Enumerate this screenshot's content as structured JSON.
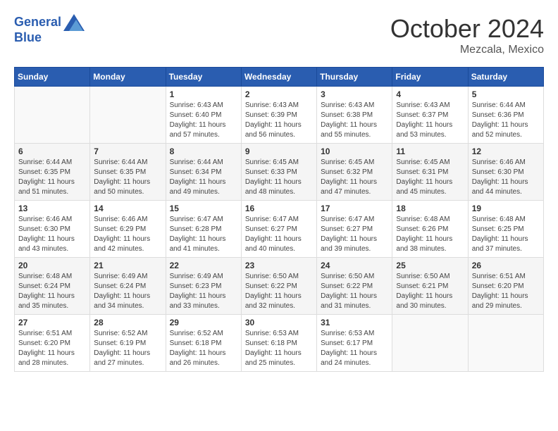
{
  "logo": {
    "line1": "General",
    "line2": "Blue"
  },
  "title": "October 2024",
  "location": "Mezcala, Mexico",
  "weekdays": [
    "Sunday",
    "Monday",
    "Tuesday",
    "Wednesday",
    "Thursday",
    "Friday",
    "Saturday"
  ],
  "weeks": [
    [
      {
        "day": "",
        "info": ""
      },
      {
        "day": "",
        "info": ""
      },
      {
        "day": "1",
        "info": "Sunrise: 6:43 AM\nSunset: 6:40 PM\nDaylight: 11 hours\nand 57 minutes."
      },
      {
        "day": "2",
        "info": "Sunrise: 6:43 AM\nSunset: 6:39 PM\nDaylight: 11 hours\nand 56 minutes."
      },
      {
        "day": "3",
        "info": "Sunrise: 6:43 AM\nSunset: 6:38 PM\nDaylight: 11 hours\nand 55 minutes."
      },
      {
        "day": "4",
        "info": "Sunrise: 6:43 AM\nSunset: 6:37 PM\nDaylight: 11 hours\nand 53 minutes."
      },
      {
        "day": "5",
        "info": "Sunrise: 6:44 AM\nSunset: 6:36 PM\nDaylight: 11 hours\nand 52 minutes."
      }
    ],
    [
      {
        "day": "6",
        "info": "Sunrise: 6:44 AM\nSunset: 6:35 PM\nDaylight: 11 hours\nand 51 minutes."
      },
      {
        "day": "7",
        "info": "Sunrise: 6:44 AM\nSunset: 6:35 PM\nDaylight: 11 hours\nand 50 minutes."
      },
      {
        "day": "8",
        "info": "Sunrise: 6:44 AM\nSunset: 6:34 PM\nDaylight: 11 hours\nand 49 minutes."
      },
      {
        "day": "9",
        "info": "Sunrise: 6:45 AM\nSunset: 6:33 PM\nDaylight: 11 hours\nand 48 minutes."
      },
      {
        "day": "10",
        "info": "Sunrise: 6:45 AM\nSunset: 6:32 PM\nDaylight: 11 hours\nand 47 minutes."
      },
      {
        "day": "11",
        "info": "Sunrise: 6:45 AM\nSunset: 6:31 PM\nDaylight: 11 hours\nand 45 minutes."
      },
      {
        "day": "12",
        "info": "Sunrise: 6:46 AM\nSunset: 6:30 PM\nDaylight: 11 hours\nand 44 minutes."
      }
    ],
    [
      {
        "day": "13",
        "info": "Sunrise: 6:46 AM\nSunset: 6:30 PM\nDaylight: 11 hours\nand 43 minutes."
      },
      {
        "day": "14",
        "info": "Sunrise: 6:46 AM\nSunset: 6:29 PM\nDaylight: 11 hours\nand 42 minutes."
      },
      {
        "day": "15",
        "info": "Sunrise: 6:47 AM\nSunset: 6:28 PM\nDaylight: 11 hours\nand 41 minutes."
      },
      {
        "day": "16",
        "info": "Sunrise: 6:47 AM\nSunset: 6:27 PM\nDaylight: 11 hours\nand 40 minutes."
      },
      {
        "day": "17",
        "info": "Sunrise: 6:47 AM\nSunset: 6:27 PM\nDaylight: 11 hours\nand 39 minutes."
      },
      {
        "day": "18",
        "info": "Sunrise: 6:48 AM\nSunset: 6:26 PM\nDaylight: 11 hours\nand 38 minutes."
      },
      {
        "day": "19",
        "info": "Sunrise: 6:48 AM\nSunset: 6:25 PM\nDaylight: 11 hours\nand 37 minutes."
      }
    ],
    [
      {
        "day": "20",
        "info": "Sunrise: 6:48 AM\nSunset: 6:24 PM\nDaylight: 11 hours\nand 35 minutes."
      },
      {
        "day": "21",
        "info": "Sunrise: 6:49 AM\nSunset: 6:24 PM\nDaylight: 11 hours\nand 34 minutes."
      },
      {
        "day": "22",
        "info": "Sunrise: 6:49 AM\nSunset: 6:23 PM\nDaylight: 11 hours\nand 33 minutes."
      },
      {
        "day": "23",
        "info": "Sunrise: 6:50 AM\nSunset: 6:22 PM\nDaylight: 11 hours\nand 32 minutes."
      },
      {
        "day": "24",
        "info": "Sunrise: 6:50 AM\nSunset: 6:22 PM\nDaylight: 11 hours\nand 31 minutes."
      },
      {
        "day": "25",
        "info": "Sunrise: 6:50 AM\nSunset: 6:21 PM\nDaylight: 11 hours\nand 30 minutes."
      },
      {
        "day": "26",
        "info": "Sunrise: 6:51 AM\nSunset: 6:20 PM\nDaylight: 11 hours\nand 29 minutes."
      }
    ],
    [
      {
        "day": "27",
        "info": "Sunrise: 6:51 AM\nSunset: 6:20 PM\nDaylight: 11 hours\nand 28 minutes."
      },
      {
        "day": "28",
        "info": "Sunrise: 6:52 AM\nSunset: 6:19 PM\nDaylight: 11 hours\nand 27 minutes."
      },
      {
        "day": "29",
        "info": "Sunrise: 6:52 AM\nSunset: 6:18 PM\nDaylight: 11 hours\nand 26 minutes."
      },
      {
        "day": "30",
        "info": "Sunrise: 6:53 AM\nSunset: 6:18 PM\nDaylight: 11 hours\nand 25 minutes."
      },
      {
        "day": "31",
        "info": "Sunrise: 6:53 AM\nSunset: 6:17 PM\nDaylight: 11 hours\nand 24 minutes."
      },
      {
        "day": "",
        "info": ""
      },
      {
        "day": "",
        "info": ""
      }
    ]
  ]
}
